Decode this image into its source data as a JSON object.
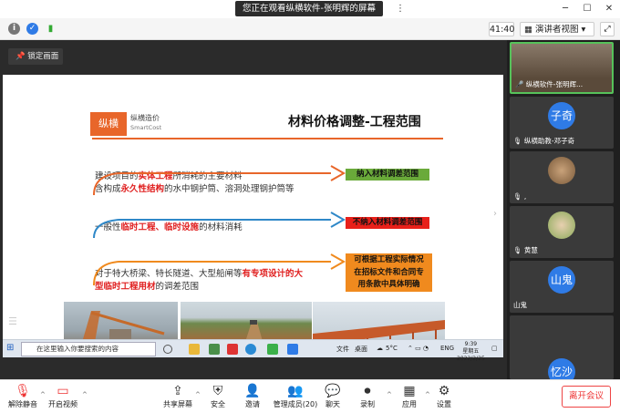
{
  "topbar": {
    "share_banner": "您正在观看纵横软件-张明辉的屏幕"
  },
  "infobar": {
    "timer": "41:40",
    "view_button": "演讲者视图"
  },
  "share": {
    "lock_button": "锁定画面",
    "slide": {
      "logo": "纵横",
      "logo_name": "纵横造价",
      "logo_sub": "SmartCost",
      "title": "材料价格调整-工程范围",
      "para1_line1_a": "建设项目的",
      "para1_line1_red": "实体工程",
      "para1_line1_b": "所消耗的主要材料",
      "para1_line2_a": "含构成",
      "para1_line2_red": "永久性结构",
      "para1_line2_b": "的水中钢护筒、溶洞处理钢护筒等",
      "tag1": "纳入材料调差范围",
      "para2_a": "一般性",
      "para2_red1": "临时工程",
      "para2_sep": "、",
      "para2_red2": "临时设施",
      "para2_b": "的材料消耗",
      "tag2": "不纳入材料调差范围",
      "para3_line1_a": "对于特大桥梁、特长隧道、大型船闸等",
      "para3_line1_red": "有专项设计的大",
      "para3_line2_red": "型临时工程用材",
      "para3_line2_b": "的调差范围",
      "tag3_line1": "可根据工程实际情况",
      "tag3_line2": "在招标文件和合同专",
      "tag3_line3": "用条款中具体明确"
    },
    "taskbar": {
      "search_placeholder": "在这里输入你要搜索的内容",
      "time": "9:39",
      "day": "星期五",
      "date": "2022/2/25",
      "temp": "5°C",
      "lang": "ENG",
      "label1": "文件",
      "label2": "桌面"
    }
  },
  "panel": {
    "tiles": [
      {
        "name": "纵横软件-张明辉..."
      },
      {
        "avatar_text": "子奇",
        "name": "纵横助教-邓子奇"
      },
      {
        "name": ","
      },
      {
        "name": "黄慧"
      },
      {
        "avatar_text": "山鬼",
        "name": "山鬼"
      },
      {
        "name": "忆沙"
      }
    ]
  },
  "bottombar": {
    "mute": "解除静音",
    "video": "开启视频",
    "share_screen": "共享屏幕",
    "security": "安全",
    "invite": "邀请",
    "manage_members": "管理成员(20)",
    "chat": "聊天",
    "record": "录制",
    "apps": "应用",
    "settings": "设置",
    "leave": "离开会议"
  },
  "colors": {
    "accent_orange": "#e8662a",
    "tag_green": "#6aaa3a",
    "tag_red": "#e8201a",
    "tag_orange": "#f08a1e",
    "speaking_border": "#56c25a"
  }
}
